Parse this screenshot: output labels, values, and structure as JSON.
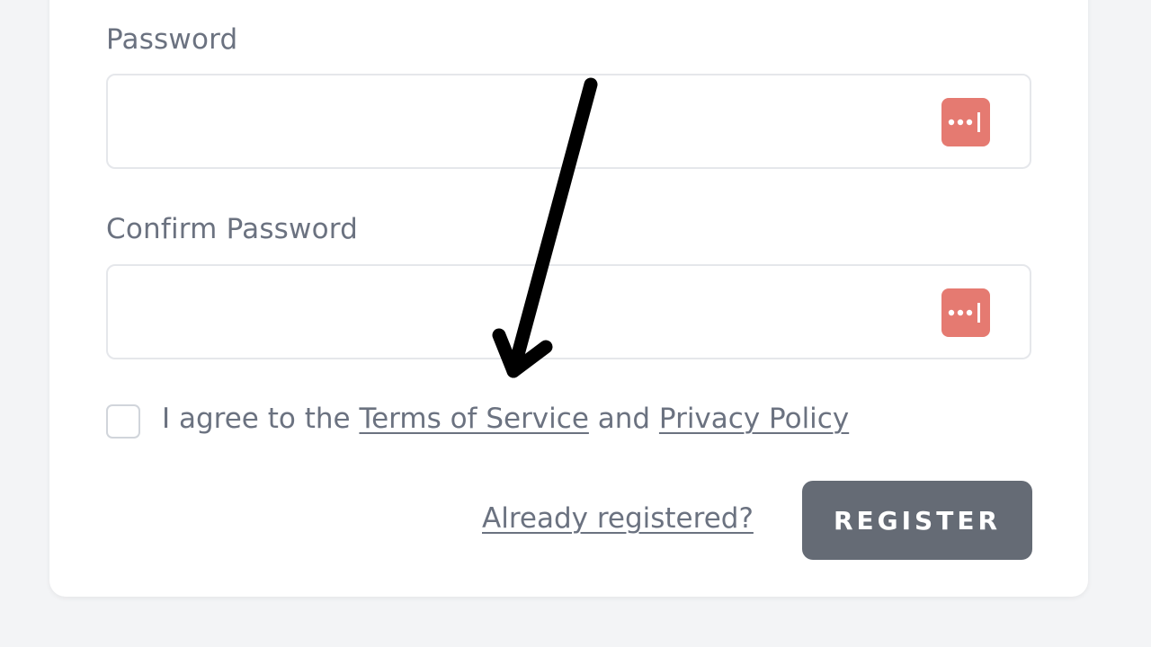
{
  "form": {
    "password_label": "Password",
    "confirm_password_label": "Confirm Password",
    "password_value": "",
    "confirm_password_value": "",
    "password_manager_icon": "password-manager-icon",
    "agree": {
      "prefix": "I agree to the ",
      "terms_link": "Terms of Service",
      "middle": " and ",
      "privacy_link": "Privacy Policy"
    },
    "already_registered_link": "Already registered?",
    "register_button": "REGISTER"
  },
  "colors": {
    "page_background": "#f3f4f6",
    "card_background": "#ffffff",
    "label_text": "#6b7280",
    "password_manager_icon": "#e57a71",
    "register_button": "#656b75",
    "annotation_arrow": "#000000"
  },
  "annotation": {
    "icon": "arrow-down-icon"
  }
}
